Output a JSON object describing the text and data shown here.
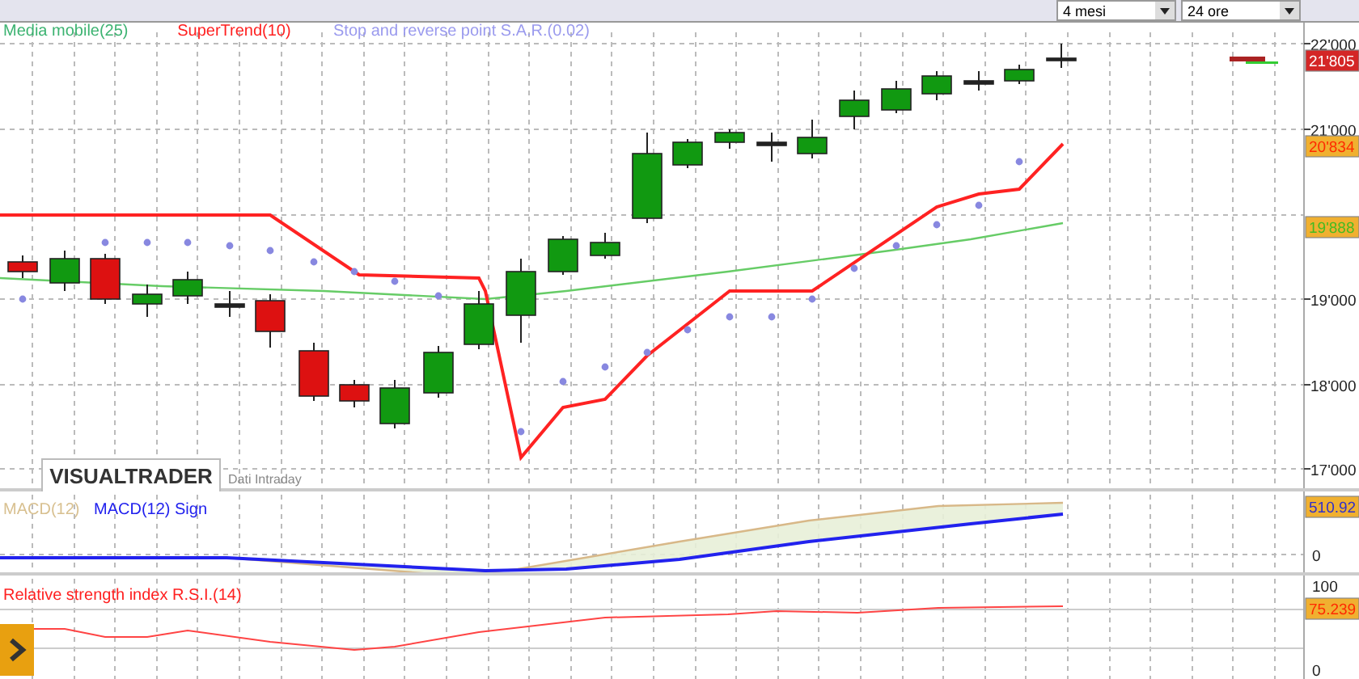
{
  "toolbar": {
    "period": "4 mesi",
    "interval": "24 ore"
  },
  "main_panel": {
    "legend": [
      {
        "label": "Media mobile(25)",
        "color": "#3cb371"
      },
      {
        "label": "SuperTrend(10)",
        "color": "#ff2020"
      },
      {
        "label": "Stop and reverse point S.A.R.(0.02)",
        "color": "#9a9aee"
      }
    ],
    "axis_labels": [
      "22'000",
      "21'000",
      "19'000",
      "18'000",
      "17'000"
    ],
    "price_tags": [
      {
        "text": "21'805",
        "kind": "last",
        "color": "#ffffff"
      },
      {
        "text": "20'834",
        "kind": "indicator",
        "color": "#ff2a00"
      },
      {
        "text": "19'888",
        "kind": "indicator",
        "color": "#44bb22"
      }
    ],
    "logo": "VISUALTRADER",
    "caption": "Dati Intraday"
  },
  "macd_panel": {
    "legend": [
      {
        "label": "MACD(12)",
        "color": "#d8c090"
      },
      {
        "label": "MACD(12) Sign",
        "color": "#2020ee"
      }
    ],
    "axis_labels": [
      "0"
    ],
    "price_tag": {
      "text": "510.92",
      "kind": "indicator",
      "color": "#3030cc"
    }
  },
  "rsi_panel": {
    "legend": [
      {
        "label": "Relative strength index R.S.I.(14)",
        "color": "#ff2020"
      }
    ],
    "axis_labels": [
      "100",
      "0"
    ],
    "price_tag": {
      "text": "75.239",
      "kind": "indicator",
      "color": "#ff2a00"
    }
  }
}
